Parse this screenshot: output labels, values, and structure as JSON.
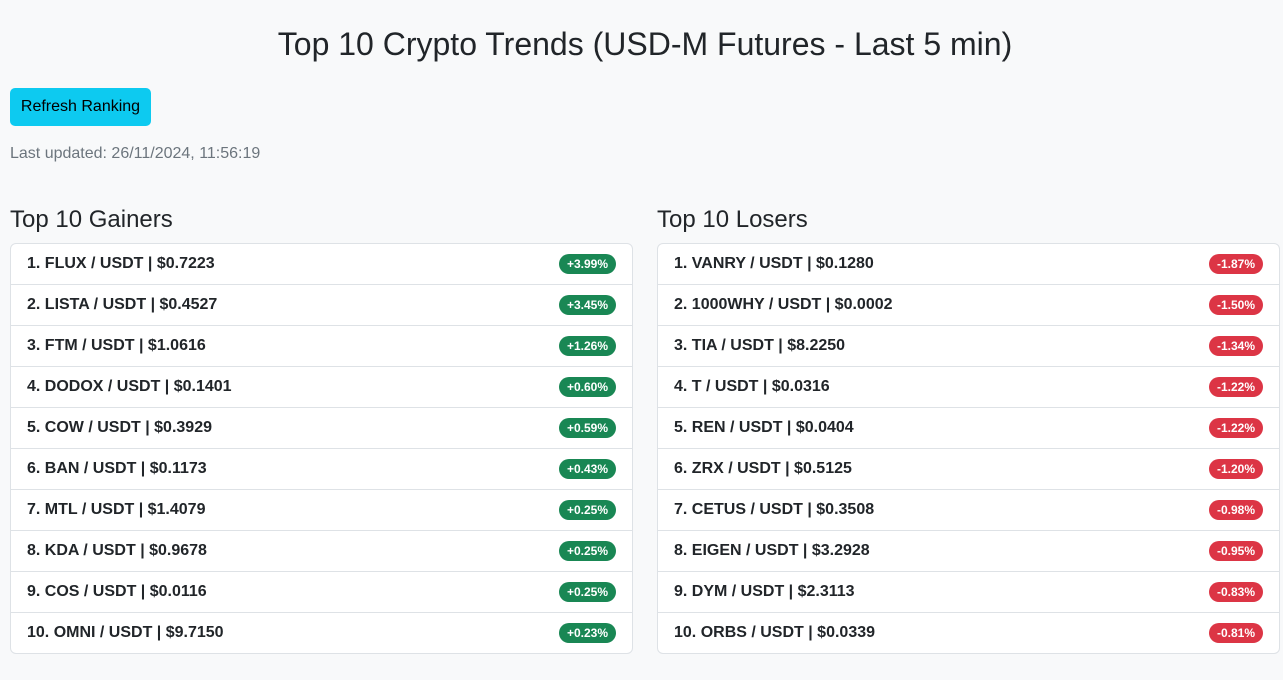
{
  "page": {
    "title": "Top 10 Crypto Trends (USD-M Futures - Last 5 min)",
    "refresh_label": "Refresh Ranking",
    "last_updated": "Last updated: 26/11/2024, 11:56:19"
  },
  "colors": {
    "gain": "#198754",
    "loss": "#dc3545",
    "refresh_button": "#0dcaf0"
  },
  "gainers": {
    "title": "Top 10 Gainers",
    "items": [
      {
        "label": "1. FLUX / USDT | $0.7223",
        "change": "+3.99%"
      },
      {
        "label": "2. LISTA / USDT | $0.4527",
        "change": "+3.45%"
      },
      {
        "label": "3. FTM / USDT | $1.0616",
        "change": "+1.26%"
      },
      {
        "label": "4. DODOX / USDT | $0.1401",
        "change": "+0.60%"
      },
      {
        "label": "5. COW / USDT | $0.3929",
        "change": "+0.59%"
      },
      {
        "label": "6. BAN / USDT | $0.1173",
        "change": "+0.43%"
      },
      {
        "label": "7. MTL / USDT | $1.4079",
        "change": "+0.25%"
      },
      {
        "label": "8. KDA / USDT | $0.9678",
        "change": "+0.25%"
      },
      {
        "label": "9. COS / USDT | $0.0116",
        "change": "+0.25%"
      },
      {
        "label": "10. OMNI / USDT | $9.7150",
        "change": "+0.23%"
      }
    ]
  },
  "losers": {
    "title": "Top 10 Losers",
    "items": [
      {
        "label": "1. VANRY / USDT | $0.1280",
        "change": "-1.87%"
      },
      {
        "label": "2. 1000WHY / USDT | $0.0002",
        "change": "-1.50%"
      },
      {
        "label": "3. TIA / USDT | $8.2250",
        "change": "-1.34%"
      },
      {
        "label": "4. T / USDT | $0.0316",
        "change": "-1.22%"
      },
      {
        "label": "5. REN / USDT | $0.0404",
        "change": "-1.22%"
      },
      {
        "label": "6. ZRX / USDT | $0.5125",
        "change": "-1.20%"
      },
      {
        "label": "7. CETUS / USDT | $0.3508",
        "change": "-0.98%"
      },
      {
        "label": "8. EIGEN / USDT | $3.2928",
        "change": "-0.95%"
      },
      {
        "label": "9. DYM / USDT | $2.3113",
        "change": "-0.83%"
      },
      {
        "label": "10. ORBS / USDT | $0.0339",
        "change": "-0.81%"
      }
    ]
  }
}
